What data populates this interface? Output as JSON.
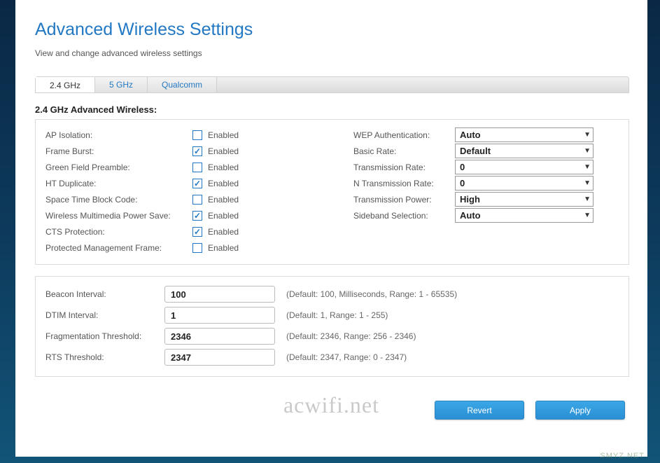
{
  "page": {
    "title": "Advanced Wireless Settings",
    "subtitle": "View and change advanced wireless settings"
  },
  "tabs": [
    {
      "label": "2.4 GHz",
      "active": true
    },
    {
      "label": "5 GHz",
      "active": false
    },
    {
      "label": "Qualcomm",
      "active": false
    }
  ],
  "section_title": "2.4 GHz Advanced Wireless:",
  "checkbox_enabled_label": "Enabled",
  "checkbox_settings": [
    {
      "label": "AP Isolation:",
      "checked": false
    },
    {
      "label": "Frame Burst:",
      "checked": true
    },
    {
      "label": "Green Field Preamble:",
      "checked": false
    },
    {
      "label": "HT Duplicate:",
      "checked": true
    },
    {
      "label": "Space Time Block Code:",
      "checked": false
    },
    {
      "label": "Wireless Multimedia Power Save:",
      "checked": true
    },
    {
      "label": "CTS Protection:",
      "checked": true
    },
    {
      "label": "Protected Management Frame:",
      "checked": false
    }
  ],
  "select_settings": [
    {
      "label": "WEP Authentication:",
      "value": "Auto"
    },
    {
      "label": "Basic Rate:",
      "value": "Default"
    },
    {
      "label": "Transmission Rate:",
      "value": "0"
    },
    {
      "label": "N Transmission Rate:",
      "value": "0"
    },
    {
      "label": "Transmission Power:",
      "value": "High"
    },
    {
      "label": "Sideband Selection:",
      "value": "Auto"
    }
  ],
  "numeric_settings": [
    {
      "label": "Beacon Interval:",
      "value": "100",
      "hint": "(Default: 100, Milliseconds, Range: 1 - 65535)"
    },
    {
      "label": "DTIM Interval:",
      "value": "1",
      "hint": "(Default: 1, Range: 1 - 255)"
    },
    {
      "label": "Fragmentation Threshold:",
      "value": "2346",
      "hint": "(Default: 2346, Range: 256 - 2346)"
    },
    {
      "label": "RTS Threshold:",
      "value": "2347",
      "hint": "(Default: 2347, Range: 0 - 2347)"
    }
  ],
  "buttons": {
    "revert": "Revert",
    "apply": "Apply"
  },
  "watermark": "acwifi.net",
  "bottom_mark": "SMYZ.NET"
}
